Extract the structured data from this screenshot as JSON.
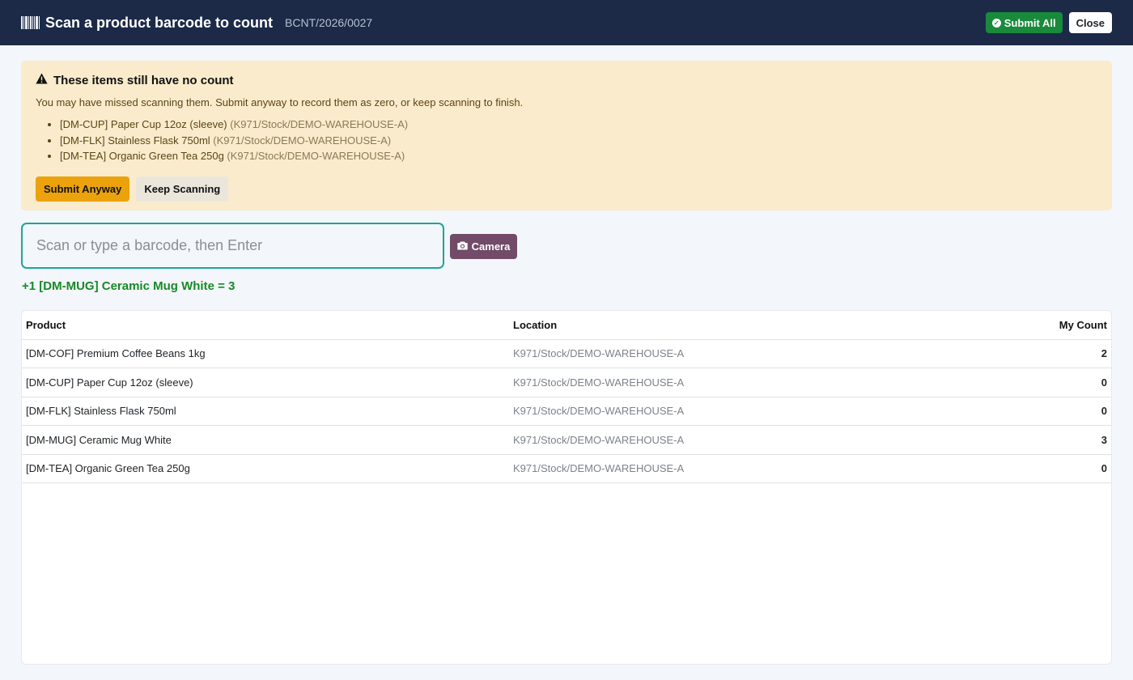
{
  "header": {
    "icon": "barcode-icon",
    "title": "Scan a product barcode to count",
    "reference": "BCNT/2026/0027",
    "submit_all_label": "Submit All",
    "close_label": "Close",
    "colors": {
      "bar": "#1c2a48",
      "submit": "#198a3c"
    }
  },
  "alert": {
    "icon": "warning-icon",
    "title": "These items still have no count",
    "description": "You may have missed scanning them. Submit anyway to record them as zero, or keep scanning to finish.",
    "items": [
      {
        "product": "[DM-CUP] Paper Cup 12oz (sleeve)",
        "location": "(K971/Stock/DEMO-WAREHOUSE-A)"
      },
      {
        "product": "[DM-FLK] Stainless Flask 750ml",
        "location": "(K971/Stock/DEMO-WAREHOUSE-A)"
      },
      {
        "product": "[DM-TEA] Organic Green Tea 250g",
        "location": "(K971/Stock/DEMO-WAREHOUSE-A)"
      }
    ],
    "submit_anyway_label": "Submit Anyway",
    "keep_scanning_label": "Keep Scanning",
    "colors": {
      "background": "#faebcc",
      "primary_button": "#eba20c"
    }
  },
  "scan": {
    "value": "",
    "placeholder": "Scan or type a barcode, then Enter",
    "camera_label": "Camera",
    "camera_icon": "camera-icon",
    "status_message": "+1 [DM-MUG] Ceramic Mug White = 3",
    "colors": {
      "input_border": "#1fa596",
      "camera": "#714b67",
      "status": "#168a26"
    }
  },
  "table": {
    "columns": [
      "Product",
      "Location",
      "My Count"
    ],
    "rows": [
      {
        "product": "[DM-COF] Premium Coffee Beans 1kg",
        "location": "K971/Stock/DEMO-WAREHOUSE-A",
        "count": "2"
      },
      {
        "product": "[DM-CUP] Paper Cup 12oz (sleeve)",
        "location": "K971/Stock/DEMO-WAREHOUSE-A",
        "count": "0"
      },
      {
        "product": "[DM-FLK] Stainless Flask 750ml",
        "location": "K971/Stock/DEMO-WAREHOUSE-A",
        "count": "0"
      },
      {
        "product": "[DM-MUG] Ceramic Mug White",
        "location": "K971/Stock/DEMO-WAREHOUSE-A",
        "count": "3"
      },
      {
        "product": "[DM-TEA] Organic Green Tea 250g",
        "location": "K971/Stock/DEMO-WAREHOUSE-A",
        "count": "0"
      }
    ]
  }
}
